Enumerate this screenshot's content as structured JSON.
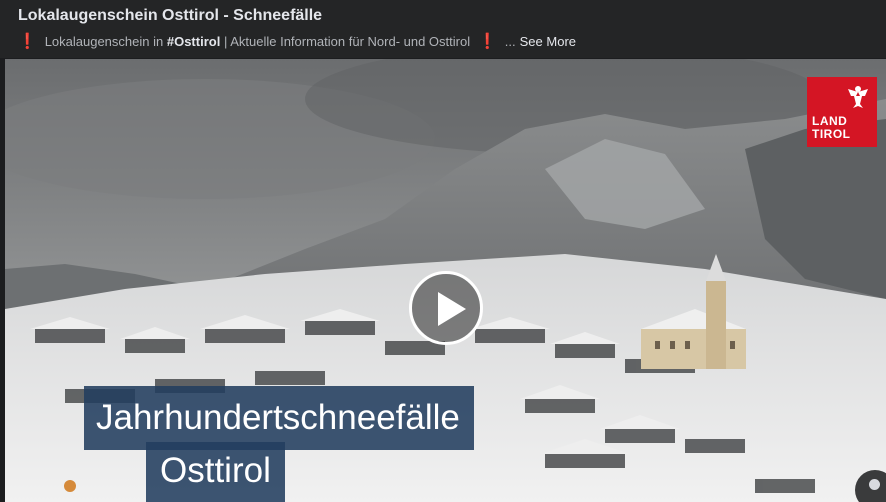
{
  "post": {
    "title": "Lokalaugenschein Osttirol - Schneefälle",
    "desc_part1": "Lokalaugenschein in",
    "hashtag": "#Osttirol",
    "desc_part2": "| Aktuelle Information für Nord- und Osttirol",
    "ellipsis": "...",
    "see_more": "See More",
    "excl_icon": "❗"
  },
  "video": {
    "logo_line1": "LAND",
    "logo_line2": "TIROL",
    "caption_line1": "Jahrhundertschneefälle",
    "caption_line2": "Osttirol",
    "play_icon": "play-icon"
  },
  "colors": {
    "accent": "#3e8ed0",
    "logo_red": "#d41524",
    "caption_bg": "#223e5e",
    "exclamation": "#e0245e"
  }
}
